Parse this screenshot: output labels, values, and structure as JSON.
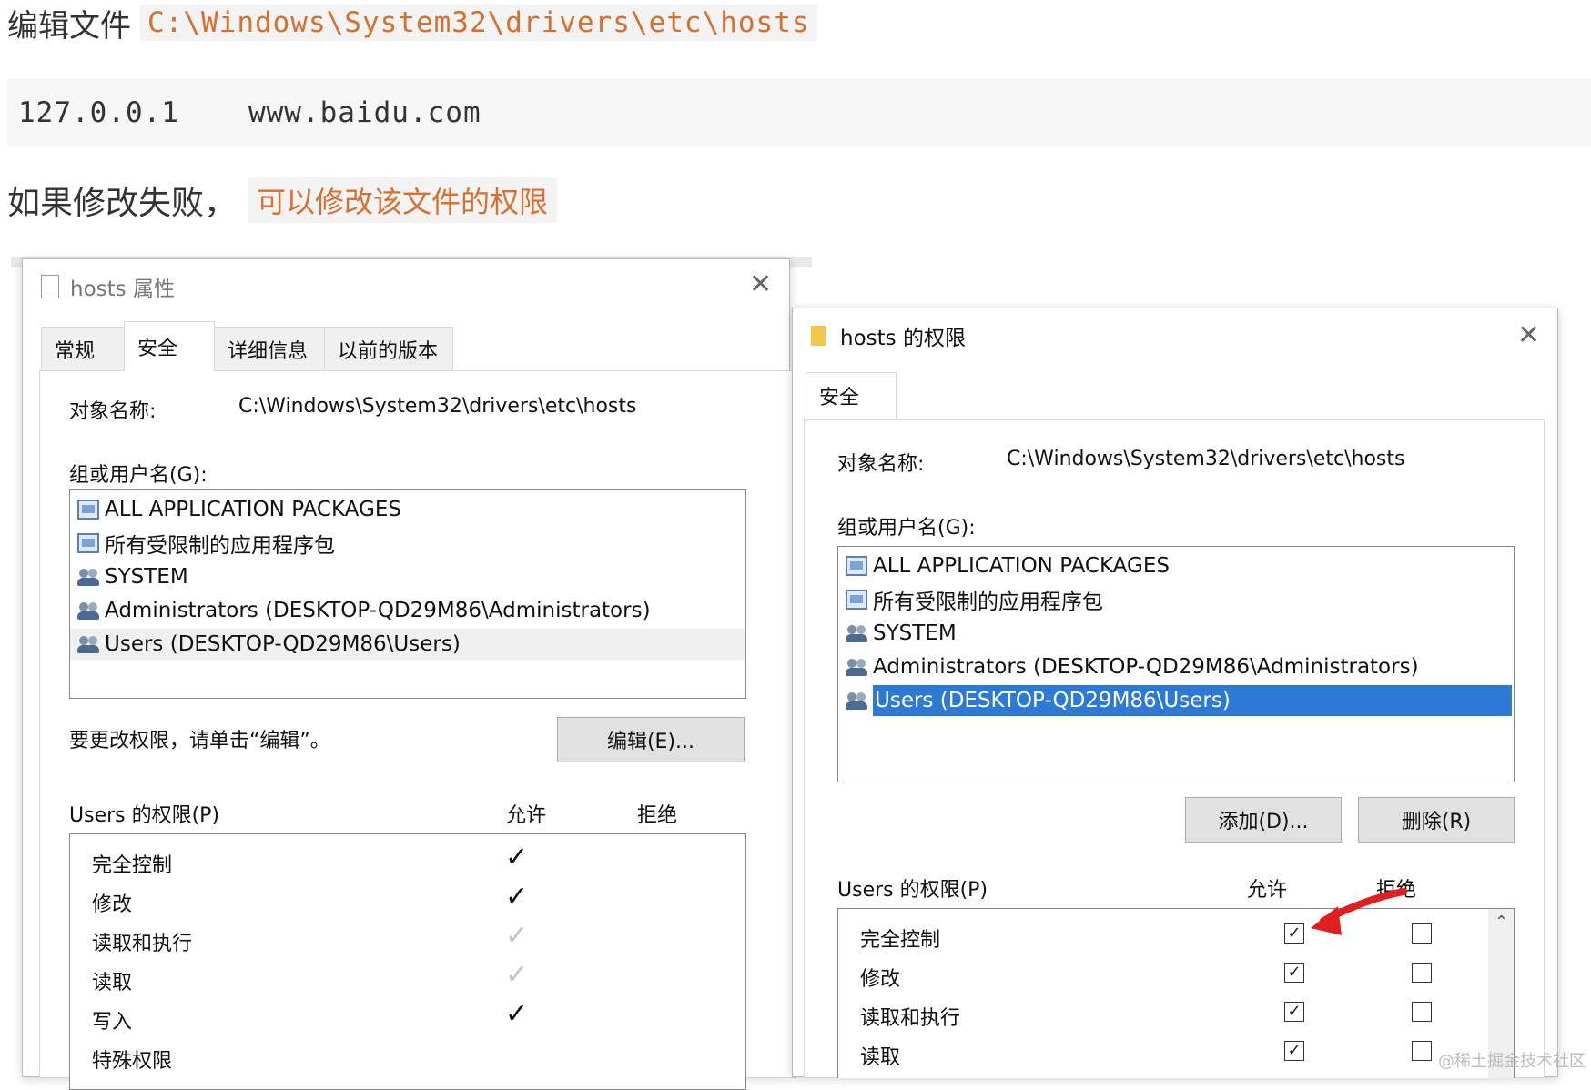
{
  "article": {
    "line1_prefix": "编辑文件",
    "line1_path": "C:\\Windows\\System32\\drivers\\etc\\hosts",
    "code_ip": "127.0.0.1",
    "code_host": "www.baidu.com",
    "line3_prefix": "如果修改失败，",
    "line3_highlight": "可以修改该文件的权限"
  },
  "props_dialog": {
    "title": "hosts 属性",
    "close": "✕",
    "tabs": [
      "常规",
      "安全",
      "详细信息",
      "以前的版本"
    ],
    "active_tab": "安全",
    "object_label": "对象名称:",
    "object_value": "C:\\Windows\\System32\\drivers\\etc\\hosts",
    "group_label": "组或用户名(G):",
    "groups": [
      {
        "icon": "package-icon",
        "name": "ALL APPLICATION PACKAGES"
      },
      {
        "icon": "package-icon",
        "name": "所有受限制的应用程序包"
      },
      {
        "icon": "users-icon",
        "name": "SYSTEM"
      },
      {
        "icon": "users-icon",
        "name": "Administrators (DESKTOP-QD29M86\\Administrators)"
      },
      {
        "icon": "users-icon",
        "name": "Users (DESKTOP-QD29M86\\Users)"
      }
    ],
    "selected_group": "Users (DESKTOP-QD29M86\\Users)",
    "change_hint": "要更改权限，请单击“编辑”。",
    "edit_button": "编辑(E)...",
    "perm_label": "Users 的权限(P)",
    "allow_header": "允许",
    "deny_header": "拒绝",
    "permissions": [
      {
        "name": "完全控制",
        "allow": "✓",
        "allow_state": "checked"
      },
      {
        "name": "修改",
        "allow": "✓",
        "allow_state": "checked"
      },
      {
        "name": "读取和执行",
        "allow": "✓",
        "allow_state": "inherited"
      },
      {
        "name": "读取",
        "allow": "✓",
        "allow_state": "inherited"
      },
      {
        "name": "写入",
        "allow": "✓",
        "allow_state": "checked"
      },
      {
        "name": "特殊权限",
        "allow": "",
        "allow_state": "none"
      }
    ]
  },
  "perm_dialog": {
    "title": "hosts 的权限",
    "close": "✕",
    "tab": "安全",
    "object_label": "对象名称:",
    "object_value": "C:\\Windows\\System32\\drivers\\etc\\hosts",
    "group_label": "组或用户名(G):",
    "groups": [
      {
        "icon": "package-icon",
        "name": "ALL APPLICATION PACKAGES"
      },
      {
        "icon": "package-icon",
        "name": "所有受限制的应用程序包"
      },
      {
        "icon": "users-icon",
        "name": "SYSTEM"
      },
      {
        "icon": "users-icon",
        "name": "Administrators (DESKTOP-QD29M86\\Administrators)"
      },
      {
        "icon": "users-icon",
        "name": "Users (DESKTOP-QD29M86\\Users)"
      }
    ],
    "selected_group": "Users (DESKTOP-QD29M86\\Users)",
    "add_button": "添加(D)...",
    "remove_button": "删除(R)",
    "perm_label": "Users 的权限(P)",
    "allow_header": "允许",
    "deny_header": "拒绝",
    "permissions": [
      {
        "name": "完全控制",
        "allow": true,
        "deny": false
      },
      {
        "name": "修改",
        "allow": true,
        "deny": false
      },
      {
        "name": "读取和执行",
        "allow": true,
        "deny": false
      },
      {
        "name": "读取",
        "allow": true,
        "deny": false
      }
    ],
    "check_glyph": "✓",
    "scroll_up": "⌃"
  },
  "colors": {
    "highlight_text": "#d86f2d",
    "selection": "#2d7ad6",
    "arrow": "#e02020"
  },
  "watermark": "@稀土掘金技术社区"
}
